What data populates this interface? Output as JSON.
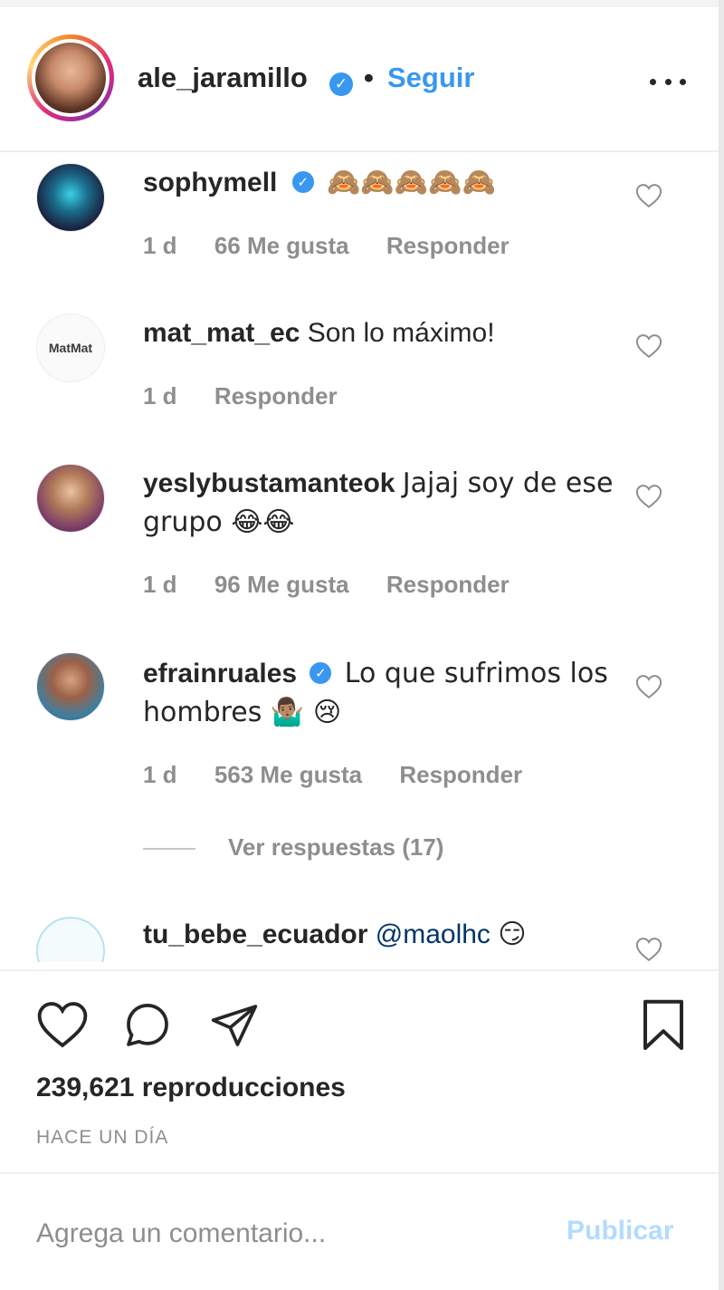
{
  "header": {
    "username": "ale_jaramillo",
    "verified": true,
    "separator": "•",
    "follow_label": "Seguir",
    "more_icon": "more-horizontal-icon"
  },
  "comments": [
    {
      "username": "sophymell",
      "verified": true,
      "text": "🙈🙈🙈🙈🙈",
      "time": "1 d",
      "likes": "66 Me gusta",
      "reply_label": "Responder"
    },
    {
      "username": "mat_mat_ec",
      "verified": false,
      "text": "Son lo máximo!",
      "time": "1 d",
      "likes": "",
      "reply_label": "Responder"
    },
    {
      "username": "yeslybustamanteok",
      "verified": false,
      "text": "Jajaj soy de ese grupo 😂😂",
      "time": "1 d",
      "likes": "96 Me gusta",
      "reply_label": "Responder"
    },
    {
      "username": "efrainruales",
      "verified": true,
      "text": "Lo que sufrimos los hombres 🤷🏽‍♂️ 😢",
      "time": "1 d",
      "likes": "563 Me gusta",
      "reply_label": "Responder",
      "view_replies": "Ver respuestas (17)"
    },
    {
      "username": "tu_bebe_ecuador",
      "verified": false,
      "mention": "@maolhc",
      "text": "😏"
    }
  ],
  "actions": {
    "like_icon": "heart-icon",
    "comment_icon": "comment-icon",
    "share_icon": "send-icon",
    "save_icon": "bookmark-icon"
  },
  "stats": {
    "views": "239,621 reproducciones",
    "date": "HACE UN DÍA"
  },
  "comment_box": {
    "placeholder": "Agrega un comentario...",
    "publish_label": "Publicar"
  },
  "colors": {
    "accent": "#3897f0",
    "muted": "#8e8e8e",
    "publish_disabled": "#b3dbff"
  }
}
